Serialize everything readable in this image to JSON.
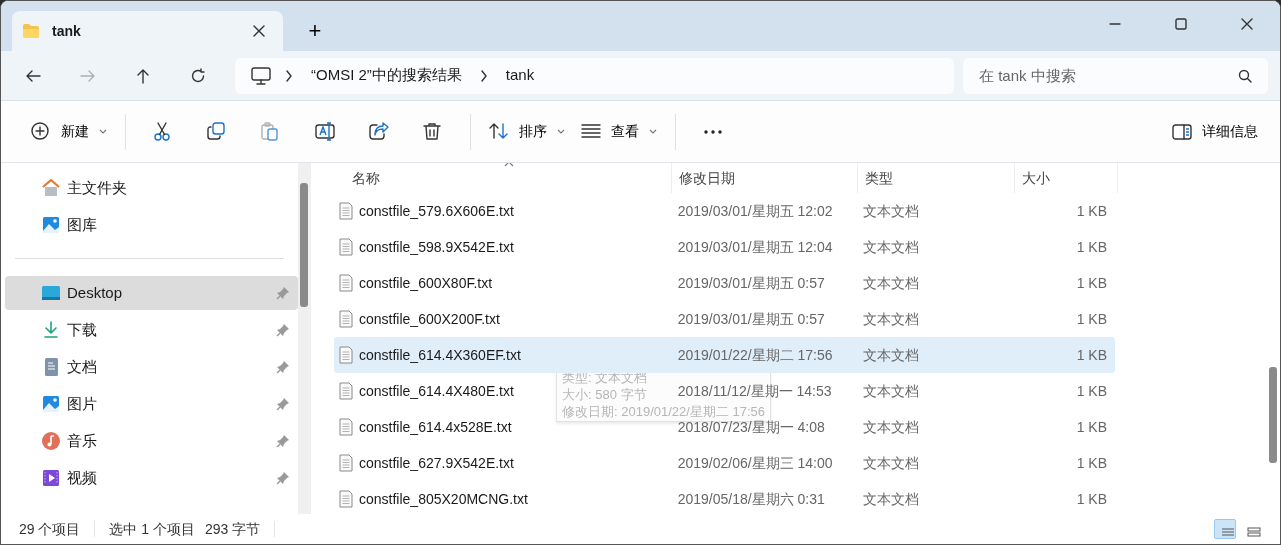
{
  "window": {
    "tab_title": "tank",
    "new_tab": "+"
  },
  "navigation": [
    {
      "kind": "back",
      "disabled": false
    },
    {
      "kind": "forward",
      "disabled": true
    },
    {
      "kind": "up",
      "disabled": false
    },
    {
      "kind": "refresh",
      "disabled": false
    }
  ],
  "address": {
    "crumbs": [
      "“OMSI 2”中的搜索结果",
      "tank"
    ]
  },
  "search": {
    "placeholder": "在 tank 中搜索"
  },
  "toolbar": [
    {
      "kind": "new",
      "label": "新建",
      "dropdown": true,
      "disabled": false
    },
    {
      "kind": "cut",
      "disabled": false
    },
    {
      "kind": "copy",
      "disabled": false
    },
    {
      "kind": "paste",
      "disabled": true
    },
    {
      "kind": "rename",
      "disabled": false
    },
    {
      "kind": "share",
      "disabled": false
    },
    {
      "kind": "delete",
      "disabled": false
    },
    {
      "kind": "sort",
      "label": "排序",
      "dropdown": true,
      "disabled": false
    },
    {
      "kind": "view",
      "label": "查看",
      "dropdown": true,
      "disabled": false
    },
    {
      "kind": "more",
      "disabled": false
    }
  ],
  "details_button": {
    "label": "详细信息"
  },
  "sidebar": {
    "groups": [
      [
        {
          "kind": "home",
          "label": "主文件夹",
          "selected": false,
          "pinned": false
        },
        {
          "kind": "gallery",
          "label": "图库",
          "selected": false,
          "pinned": false
        }
      ],
      [
        {
          "kind": "desktop",
          "label": "Desktop",
          "selected": true,
          "pinned": true
        },
        {
          "kind": "downloads",
          "label": "下载",
          "selected": false,
          "pinned": true
        },
        {
          "kind": "documents",
          "label": "文档",
          "selected": false,
          "pinned": true
        },
        {
          "kind": "pictures",
          "label": "图片",
          "selected": false,
          "pinned": true
        },
        {
          "kind": "music",
          "label": "音乐",
          "selected": false,
          "pinned": true
        },
        {
          "kind": "videos",
          "label": "视频",
          "selected": false,
          "pinned": true
        }
      ]
    ]
  },
  "table": {
    "columns": [
      {
        "label": "名称",
        "sorted": true
      },
      {
        "label": "修改日期",
        "sorted": false
      },
      {
        "label": "类型",
        "sorted": false
      },
      {
        "label": "大小",
        "sorted": false
      }
    ],
    "rows": [
      {
        "name": "constfile_579.6X606E.txt",
        "modified": "2019/03/01/星期五 12:02",
        "type": "文本文档",
        "size": "1 KB",
        "selected": false
      },
      {
        "name": "constfile_598.9X542E.txt",
        "modified": "2019/03/01/星期五 12:04",
        "type": "文本文档",
        "size": "1 KB",
        "selected": false
      },
      {
        "name": "constfile_600X80F.txt",
        "modified": "2019/03/01/星期五 0:57",
        "type": "文本文档",
        "size": "1 KB",
        "selected": false
      },
      {
        "name": "constfile_600X200F.txt",
        "modified": "2019/03/01/星期五 0:57",
        "type": "文本文档",
        "size": "1 KB",
        "selected": false
      },
      {
        "name": "constfile_614.4X360EF.txt",
        "modified": "2019/01/22/星期二 17:56",
        "type": "文本文档",
        "size": "1 KB",
        "selected": true
      },
      {
        "name": "constfile_614.4X480E.txt",
        "modified": "2018/11/12/星期一 14:53",
        "type": "文本文档",
        "size": "1 KB",
        "selected": false
      },
      {
        "name": "constfile_614.4x528E.txt",
        "modified": "2018/07/23/星期一 4:08",
        "type": "文本文档",
        "size": "1 KB",
        "selected": false
      },
      {
        "name": "constfile_627.9X542E.txt",
        "modified": "2019/02/06/星期三 14:00",
        "type": "文本文档",
        "size": "1 KB",
        "selected": false
      },
      {
        "name": "constfile_805X20MCNG.txt",
        "modified": "2019/05/18/星期六 0:31",
        "type": "文本文档",
        "size": "1 KB",
        "selected": false
      }
    ]
  },
  "tooltip": {
    "lines": [
      "类型: 文本文档",
      "大小: 580 字节",
      "修改日期: 2019/01/22/星期二 17:56"
    ]
  },
  "status_bar": {
    "count": "29 个项目",
    "selection": "选中 1 个项目",
    "size": "293 字节"
  },
  "view_buttons": [
    {
      "kind": "details",
      "selected": true
    },
    {
      "kind": "tiles",
      "selected": false
    }
  ]
}
